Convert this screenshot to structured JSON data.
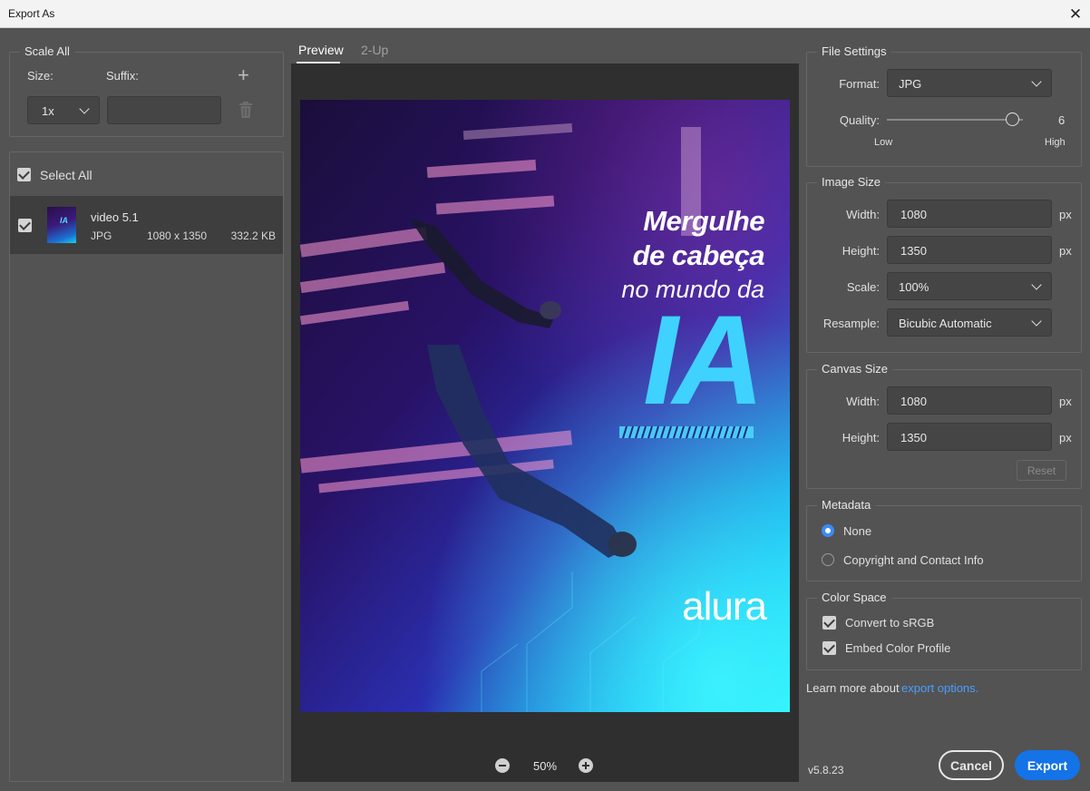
{
  "window": {
    "title": "Export As",
    "close_glyph": "✕"
  },
  "scale_all": {
    "legend": "Scale All",
    "size_label": "Size:",
    "suffix_label": "Suffix:",
    "size_value": "1x",
    "suffix_value": "",
    "add_glyph": "+"
  },
  "assets": {
    "select_all_label": "Select All",
    "items": [
      {
        "name": "video 5.1",
        "format": "JPG",
        "dimensions": "1080 x 1350",
        "size": "332.2 KB"
      }
    ]
  },
  "tabs": {
    "preview": "Preview",
    "two_up": "2-Up"
  },
  "poster": {
    "line1": "Mergulhe",
    "line2": "de cabeça",
    "line3": "no mundo da",
    "big": "IA",
    "brand": "alura"
  },
  "zoom": {
    "value": "50%"
  },
  "file_settings": {
    "legend": "File Settings",
    "format_label": "Format:",
    "format_value": "JPG",
    "quality_label": "Quality:",
    "quality_value": "6",
    "quality_level": 0.92,
    "low_label": "Low",
    "high_label": "High"
  },
  "image_size": {
    "legend": "Image Size",
    "width_label": "Width:",
    "width_value": "1080",
    "height_label": "Height:",
    "height_value": "1350",
    "scale_label": "Scale:",
    "scale_value": "100%",
    "resample_label": "Resample:",
    "resample_value": "Bicubic Automatic",
    "unit": "px"
  },
  "canvas_size": {
    "legend": "Canvas Size",
    "width_label": "Width:",
    "width_value": "1080",
    "height_label": "Height:",
    "height_value": "1350",
    "unit": "px",
    "reset_label": "Reset"
  },
  "metadata": {
    "legend": "Metadata",
    "none_label": "None",
    "copyright_label": "Copyright and Contact Info"
  },
  "color_space": {
    "legend": "Color Space",
    "convert_label": "Convert to sRGB",
    "embed_label": "Embed Color Profile"
  },
  "footer": {
    "learn_text": "Learn more about",
    "learn_link": "export options.",
    "version": "v5.8.23",
    "cancel_label": "Cancel",
    "export_label": "Export"
  },
  "colors": {
    "accent": "#1473e6",
    "link": "#4a9eff",
    "panel": "#535353",
    "preview_bg": "#2f2f2f"
  }
}
